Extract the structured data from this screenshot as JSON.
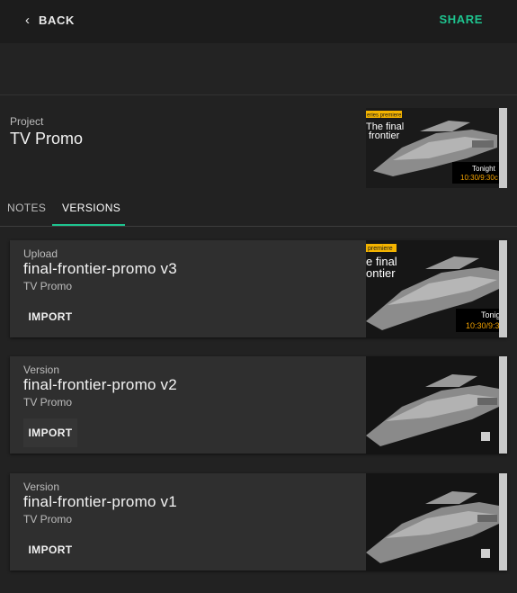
{
  "topbar": {
    "back_label": "BACK",
    "share_label": "SHARE",
    "accent": "#1ec48f"
  },
  "project": {
    "label": "Project",
    "title": "TV Promo",
    "thumbnail": {
      "badge": "eries premiere",
      "headline_1": "The final",
      "headline_2": "frontier",
      "tonight": "Tonight",
      "time": "10:30/9:30c"
    }
  },
  "tabs": [
    {
      "label": "NOTES",
      "active": false
    },
    {
      "label": "VERSIONS",
      "active": true
    }
  ],
  "versions": [
    {
      "eyebrow": "Upload",
      "title": "final-frontier-promo v3",
      "subtitle": "TV Promo",
      "import_label": "IMPORT",
      "thumbnail": {
        "badge": "premiere",
        "headline_1": "e final",
        "headline_2": "ontier",
        "tonight": "Tonig",
        "time": "10:30/9:3"
      }
    },
    {
      "eyebrow": "Version",
      "title": "final-frontier-promo v2",
      "subtitle": "TV Promo",
      "import_label": "IMPORT"
    },
    {
      "eyebrow": "Version",
      "title": "final-frontier-promo v1",
      "subtitle": "TV Promo",
      "import_label": "IMPORT"
    }
  ]
}
